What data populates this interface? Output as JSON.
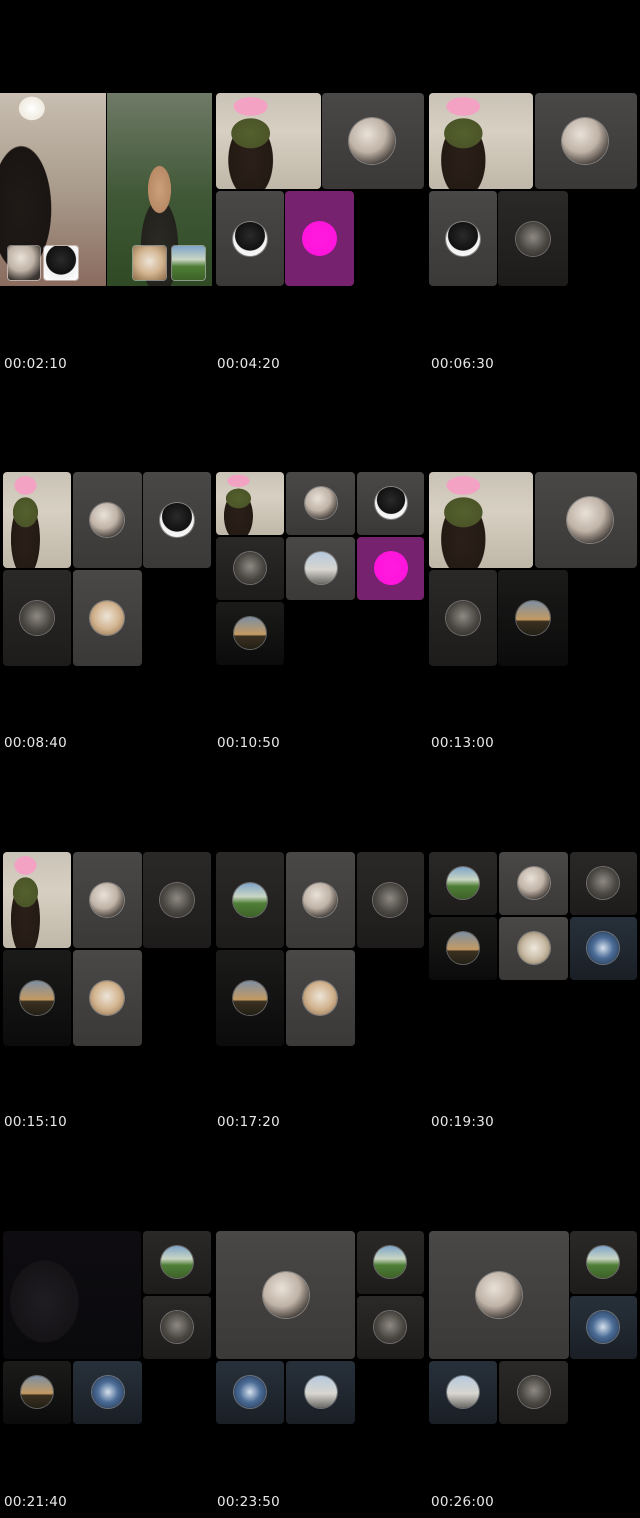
{
  "timestamps": [
    "00:02:10",
    "00:04:20",
    "00:06:30",
    "00:08:40",
    "00:10:50",
    "00:13:00",
    "00:15:10",
    "00:17:20",
    "00:19:30",
    "00:21:40",
    "00:23:50",
    "00:26:00"
  ],
  "frames": [
    {
      "tiles": [
        {
          "kind": "room",
          "label": "camera-feed-room"
        },
        {
          "kind": "forest",
          "label": "camera-feed-forest"
        }
      ]
    },
    {
      "tiles": [
        {
          "kind": "face"
        },
        {
          "kind": "grey",
          "avatar": "sel"
        },
        {
          "kind": "grey",
          "avatar": "blk"
        },
        {
          "kind": "mag",
          "avatar": "pink"
        }
      ]
    },
    {
      "tiles": [
        {
          "kind": "face"
        },
        {
          "kind": "grey",
          "avatar": "sel"
        },
        {
          "kind": "grey",
          "avatar": "blk"
        },
        {
          "kind": "dark",
          "avatar": "sk"
        }
      ]
    },
    {
      "tiles": [
        {
          "kind": "face"
        },
        {
          "kind": "grey",
          "avatar": "sel"
        },
        {
          "kind": "grey",
          "avatar": "blk"
        },
        {
          "kind": "dark",
          "avatar": "sk"
        },
        {
          "kind": "grey",
          "avatar": "br"
        }
      ]
    },
    {
      "tiles": [
        {
          "kind": "face"
        },
        {
          "kind": "grey",
          "avatar": "sel"
        },
        {
          "kind": "grey",
          "avatar": "blk"
        },
        {
          "kind": "dark",
          "avatar": "sk"
        },
        {
          "kind": "grey",
          "avatar": "rd"
        },
        {
          "kind": "mag",
          "avatar": "pink"
        },
        {
          "kind": "darker",
          "avatar": "sun"
        }
      ]
    },
    {
      "tiles": [
        {
          "kind": "face"
        },
        {
          "kind": "grey",
          "avatar": "sel"
        },
        {
          "kind": "dark",
          "avatar": "sk"
        },
        {
          "kind": "darker",
          "avatar": "sun"
        }
      ]
    },
    {
      "tiles": [
        {
          "kind": "face"
        },
        {
          "kind": "grey",
          "avatar": "sel"
        },
        {
          "kind": "dark",
          "avatar": "sk"
        },
        {
          "kind": "darker",
          "avatar": "sun"
        },
        {
          "kind": "grey",
          "avatar": "br"
        }
      ]
    },
    {
      "tiles": [
        {
          "kind": "dark",
          "avatar": "gr"
        },
        {
          "kind": "grey",
          "avatar": "sel"
        },
        {
          "kind": "dark",
          "avatar": "sk"
        },
        {
          "kind": "darker",
          "avatar": "sun"
        },
        {
          "kind": "grey",
          "avatar": "br"
        }
      ]
    },
    {
      "tiles": [
        {
          "kind": "dark",
          "avatar": "gr"
        },
        {
          "kind": "grey",
          "avatar": "sel"
        },
        {
          "kind": "dark",
          "avatar": "sk"
        },
        {
          "kind": "darker",
          "avatar": "sun"
        },
        {
          "kind": "grey",
          "avatar": "door"
        },
        {
          "kind": "blue",
          "avatar": "tr"
        }
      ]
    },
    {
      "tiles": [
        {
          "kind": "night"
        },
        {
          "kind": "dark",
          "avatar": "gr"
        },
        {
          "kind": "dark",
          "avatar": "sk"
        },
        {
          "kind": "darker",
          "avatar": "sun"
        },
        {
          "kind": "blue",
          "avatar": "tr"
        }
      ]
    },
    {
      "tiles": [
        {
          "kind": "grey",
          "avatar": "sel"
        },
        {
          "kind": "dark",
          "avatar": "gr"
        },
        {
          "kind": "dark",
          "avatar": "sk"
        },
        {
          "kind": "blue",
          "avatar": "tr"
        },
        {
          "kind": "blue",
          "avatar": "rd"
        }
      ]
    },
    {
      "tiles": [
        {
          "kind": "grey",
          "avatar": "sel"
        },
        {
          "kind": "dark",
          "avatar": "gr"
        },
        {
          "kind": "blue",
          "avatar": "tr"
        },
        {
          "kind": "blue",
          "avatar": "rd"
        },
        {
          "kind": "dark",
          "avatar": "sk"
        }
      ]
    }
  ]
}
